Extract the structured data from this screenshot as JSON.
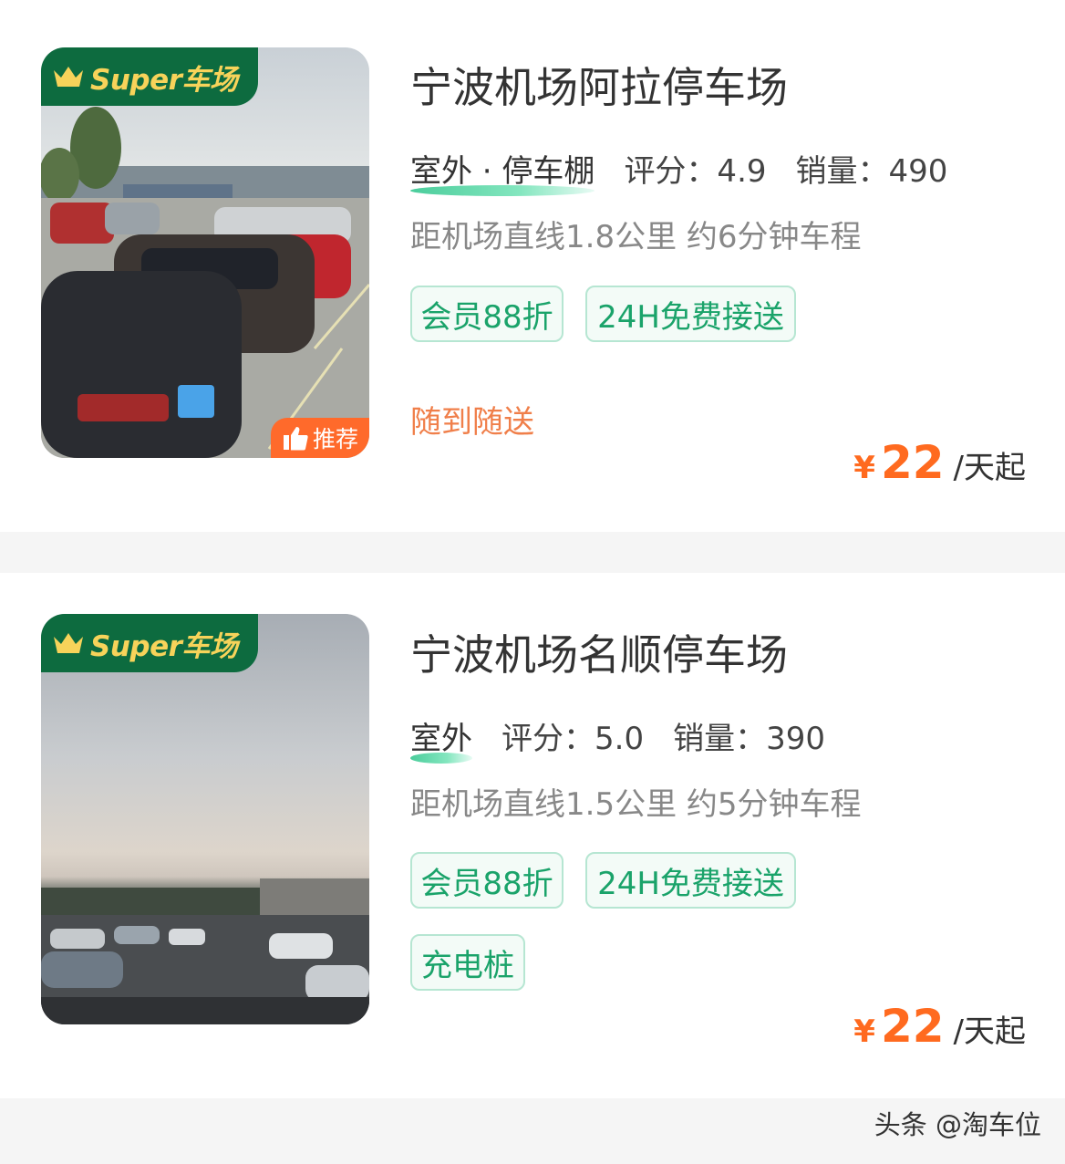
{
  "listings": [
    {
      "super_label": "Super车场",
      "recommend_label": "推荐",
      "title": "宁波机场阿拉停车场",
      "env": "室外 · 停车棚",
      "score": "评分：4.9",
      "sales": "销量：490",
      "distance": "距机场直线1.8公里 约6分钟车程",
      "tags": [
        "会员88折",
        "24H免费接送"
      ],
      "delivery": "随到随送",
      "price_currency": "¥",
      "price_value": "22",
      "price_unit": "/天起"
    },
    {
      "super_label": "Super车场",
      "title": "宁波机场名顺停车场",
      "env": "室外",
      "score": "评分：5.0",
      "sales": "销量：390",
      "distance": "距机场直线1.5公里 约5分钟车程",
      "tags": [
        "会员88折",
        "24H免费接送",
        "充电桩"
      ],
      "price_currency": "¥",
      "price_value": "22",
      "price_unit": "/天起"
    }
  ],
  "watermark": "头条 @淘车位",
  "colors": {
    "brand_green": "#0d6b3f",
    "tag_green": "#1aa36a",
    "price_orange": "#ff6a1f",
    "recommend_orange": "#ff6a2b"
  }
}
